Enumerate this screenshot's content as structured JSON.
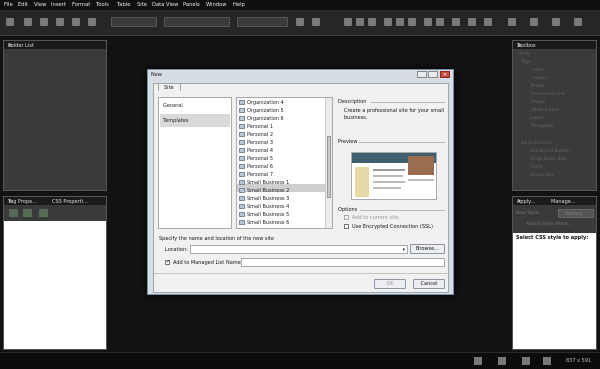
{
  "menu": [
    "File",
    "Edit",
    "View",
    "Insert",
    "Format",
    "Tools",
    "Table",
    "Site",
    "Data View",
    "Panels",
    "Window",
    "Help"
  ],
  "panels": {
    "folder_list": "Folder List",
    "toolbox": "Toolbox",
    "toolbox_items": [
      "HTML",
      "Tags",
      "<div>",
      "<span>",
      "Break",
      "Horizontal Line",
      "Image",
      "Inline Frame",
      "Layer",
      "Paragraph",
      "Form Controls",
      "Advanced Button",
      "Drop-Down Box",
      "Form",
      "Group Box"
    ],
    "tag_properties": "Tag Prope...",
    "css_properties": "CSS Properti...",
    "apply_styles": "Apply...",
    "manage_styles": "Manage...",
    "new_style": "New Style...",
    "options": "Options",
    "attach_style_sheet": "Attach Style Sheet...",
    "select_css": "Select CSS style to apply:"
  },
  "dialog": {
    "title": "New",
    "tab": "Site",
    "categories": [
      "General",
      "Templates"
    ],
    "selected_category": "Templates",
    "templates": [
      "Organization 4",
      "Organization 5",
      "Organization 6",
      "Personal 1",
      "Personal 2",
      "Personal 3",
      "Personal 4",
      "Personal 5",
      "Personal 6",
      "Personal 7",
      "Small Business 1",
      "Small Business 2",
      "Small Business 3",
      "Small Business 4",
      "Small Business 5",
      "Small Business 6"
    ],
    "selected_template": "Small Business 2",
    "description_label": "Description",
    "description_text_1": "Create a professional site for your small",
    "description_text_2": "business.",
    "preview_label": "Preview",
    "options_label": "Options",
    "add_to_current": "Add to current site",
    "use_ssl": "Use Encrypted Connection (SSL)",
    "specify_label": "Specify the name and location of the new site",
    "location_label": "Location:",
    "location_value": "",
    "browse_label": "Browse...",
    "add_managed": "Add to Managed List",
    "name_label": "Name:",
    "name_value": "",
    "ok_label": "OK",
    "cancel_label": "Cancel"
  },
  "status": {
    "size": "837 x 591"
  }
}
